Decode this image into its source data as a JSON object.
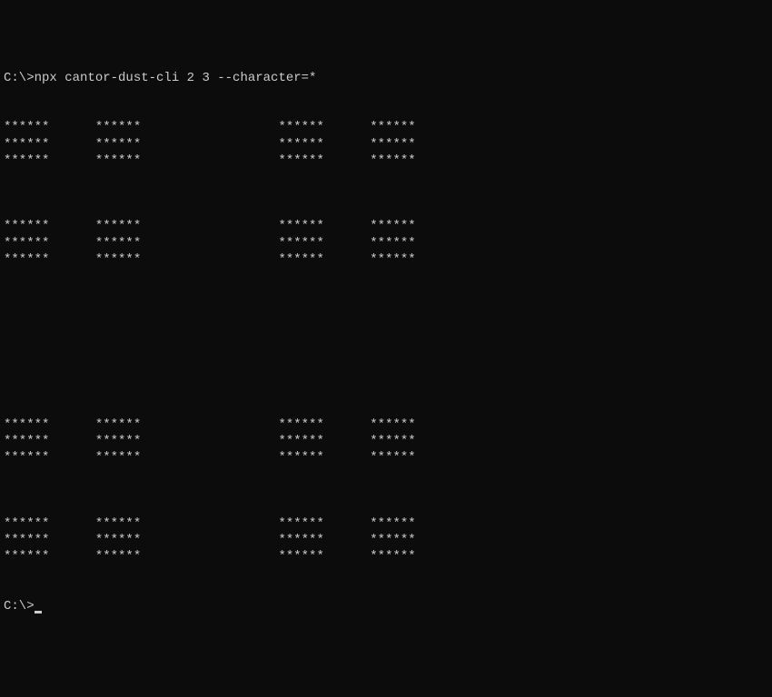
{
  "terminal": {
    "prompt1": "C:\\>",
    "command": "npx cantor-dust-cli 2 3 --character=*",
    "prompt2": "C:\\>",
    "output_lines": [
      "",
      "******      ******                  ******      ******",
      "******      ******                  ******      ******",
      "******      ******                  ******      ******",
      "",
      "",
      "",
      "******      ******                  ******      ******",
      "******      ******                  ******      ******",
      "******      ******                  ******      ******",
      "",
      "",
      "",
      "",
      "",
      "",
      "",
      "",
      "",
      "******      ******                  ******      ******",
      "******      ******                  ******      ******",
      "******      ******                  ******      ******",
      "",
      "",
      "",
      "******      ******                  ******      ******",
      "******      ******                  ******      ******",
      "******      ******                  ******      ******",
      ""
    ]
  }
}
